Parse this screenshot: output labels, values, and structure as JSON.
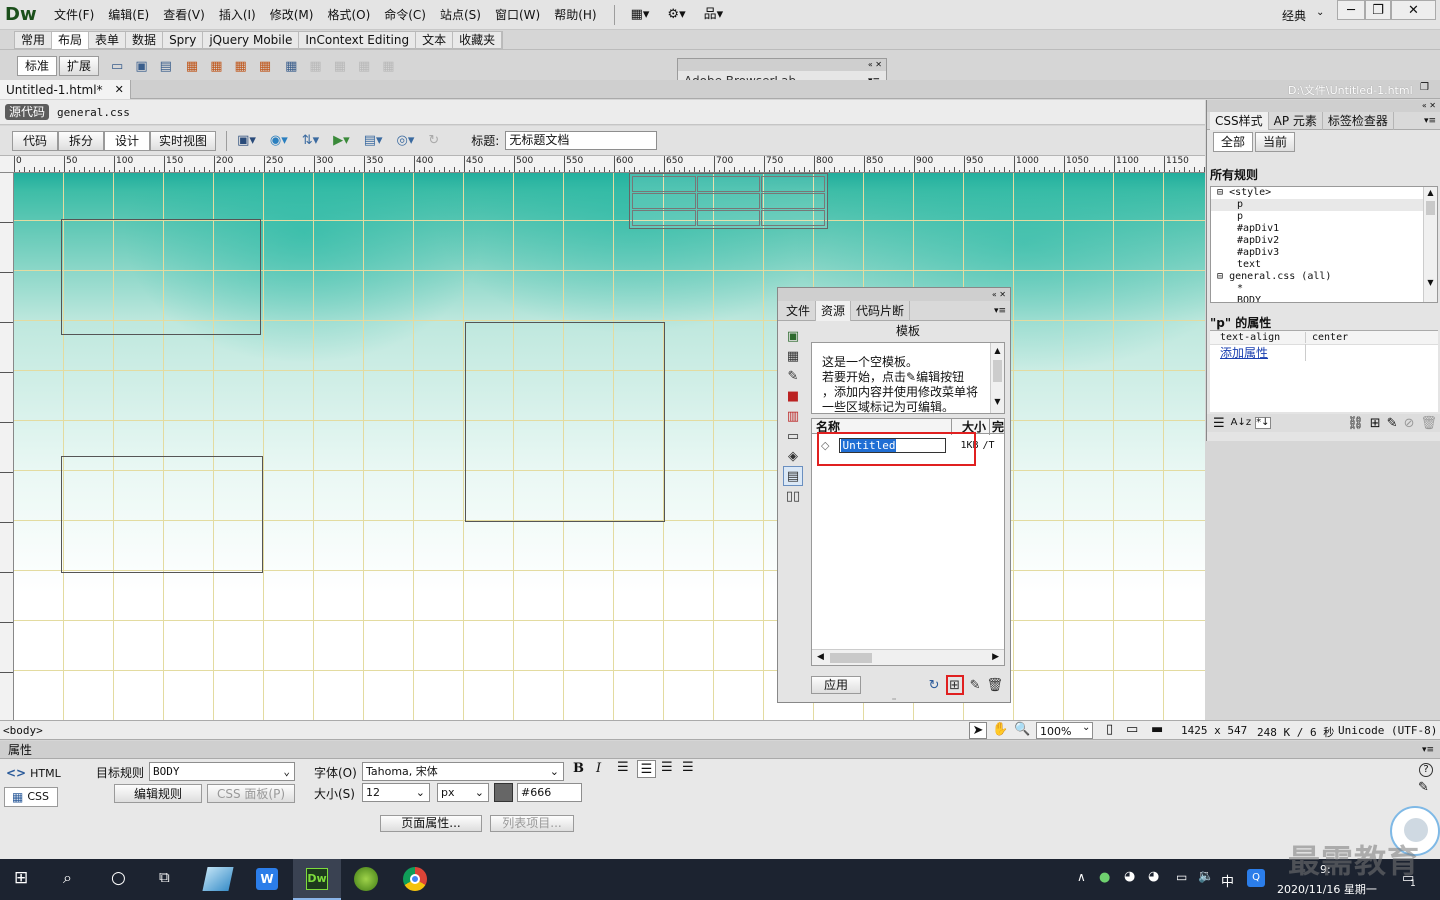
{
  "app": {
    "logo": "Dw",
    "workspace": "经典"
  },
  "menu": [
    "文件(F)",
    "编辑(E)",
    "查看(V)",
    "插入(I)",
    "修改(M)",
    "格式(O)",
    "命令(C)",
    "站点(S)",
    "窗口(W)",
    "帮助(H)"
  ],
  "insert_tabs": [
    "常用",
    "布局",
    "表单",
    "数据",
    "Spry",
    "jQuery Mobile",
    "InContext Editing",
    "文本",
    "收藏夹"
  ],
  "layout_buttons": {
    "standard": "标准",
    "expand": "扩展"
  },
  "browserlab": {
    "title": "Adobe BrowserLab"
  },
  "document": {
    "tab": "Untitled-1.html*",
    "path": "D:\\文件\\Untitled-1.html",
    "source_code": "源代码",
    "related_file": "general.css",
    "view_buttons": {
      "code": "代码",
      "split": "拆分",
      "design": "设计",
      "live": "实时视图"
    },
    "title_label": "标题:",
    "title_value": "无标题文档"
  },
  "ruler_labels": [
    "0",
    "50",
    "100",
    "150",
    "200",
    "250",
    "300",
    "350",
    "400",
    "450",
    "500",
    "550",
    "600",
    "650",
    "700",
    "750",
    "800",
    "850",
    "900",
    "950",
    "1000",
    "1050",
    "1100",
    "1150"
  ],
  "assets_panel": {
    "tabs": [
      "文件",
      "资源",
      "代码片断"
    ],
    "category": "模板",
    "preview_lines": [
      "这是一个空模板。",
      "若要开始，点击",
      "编辑按钮",
      "，添加内容并使用修改菜单将",
      "一些区域标记为可编辑。"
    ],
    "col_name": "名称",
    "col_size": "大小",
    "col_path": "完",
    "item_name": "Untitled",
    "item_size": "1KB",
    "item_path": "/T",
    "apply_button": "应用"
  },
  "css_panel": {
    "tabs": [
      "CSS样式",
      "AP 元素",
      "标签检查器"
    ],
    "mode_all": "全部",
    "mode_current": "当前",
    "all_rules_label": "所有规则",
    "tree": [
      "<style>",
      "p",
      "p",
      "#apDiv1",
      "#apDiv2",
      "#apDiv3",
      "text",
      "general.css (all)",
      "*",
      "BODY"
    ],
    "props_title": "\"p\" 的属性",
    "prop_name": "text-align",
    "prop_value": "center",
    "add_property": "添加属性"
  },
  "status_bar": {
    "tag": "<body>",
    "zoom": "100%",
    "dimensions": "1425 x 547",
    "download": "248 K / 6 秒",
    "encoding": "Unicode (UTF-8)"
  },
  "properties": {
    "title": "属性",
    "html_btn": "HTML",
    "css_btn": "CSS",
    "target_rule_label": "目标规则",
    "target_rule_value": "BODY",
    "edit_rule": "编辑规则",
    "css_panel_btn": "CSS 面板(P)",
    "font_label": "字体(O)",
    "font_value": "Tahoma, 宋体",
    "size_label": "大小(S)",
    "size_value": "12",
    "size_unit": "px",
    "color_value": "#666",
    "page_props": "页面属性...",
    "list_item": "列表项目..."
  },
  "taskbar": {
    "time": "9:",
    "date": "2020/11/16 星期一",
    "ime": "中",
    "notif_count": "1"
  },
  "watermark": "最需教育",
  "colors": {
    "canvas_teal": "#2ab8a4",
    "grid": "#e3dba0",
    "highlight": "#e02020",
    "selection": "#1f6ed4",
    "taskbar": "#1c2330"
  }
}
